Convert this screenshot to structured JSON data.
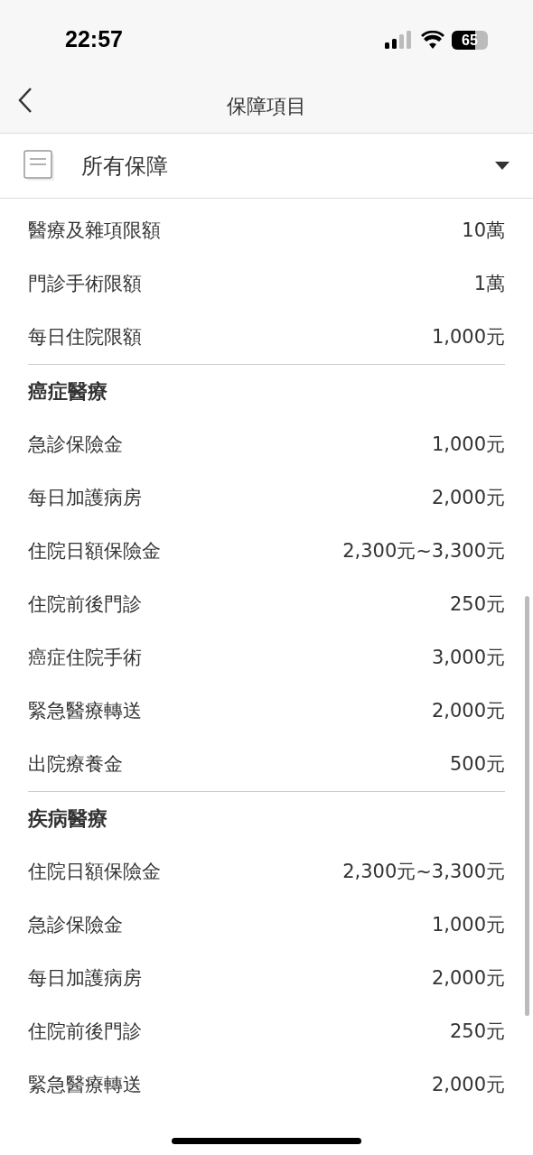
{
  "status_bar": {
    "time": "22:57",
    "battery": "65"
  },
  "nav": {
    "title": "保障項目"
  },
  "filter": {
    "label": "所有保障"
  },
  "sections": [
    {
      "rows": [
        {
          "label": "醫療及雜項限額",
          "value": "10萬"
        },
        {
          "label": "門診手術限額",
          "value": "1萬"
        },
        {
          "label": "每日住院限額",
          "value": "1,000元"
        }
      ]
    },
    {
      "title": "癌症醫療",
      "rows": [
        {
          "label": "急診保險金",
          "value": "1,000元"
        },
        {
          "label": "每日加護病房",
          "value": "2,000元"
        },
        {
          "label": "住院日額保險金",
          "value": "2,300元~3,300元"
        },
        {
          "label": "住院前後門診",
          "value": "250元"
        },
        {
          "label": "癌症住院手術",
          "value": "3,000元"
        },
        {
          "label": "緊急醫療轉送",
          "value": "2,000元"
        },
        {
          "label": "出院療養金",
          "value": "500元"
        }
      ]
    },
    {
      "title": "疾病醫療",
      "rows": [
        {
          "label": "住院日額保險金",
          "value": "2,300元~3,300元"
        },
        {
          "label": "急診保險金",
          "value": "1,000元"
        },
        {
          "label": "每日加護病房",
          "value": "2,000元"
        },
        {
          "label": "住院前後門診",
          "value": "250元"
        },
        {
          "label": "緊急醫療轉送",
          "value": "2,000元"
        }
      ]
    }
  ]
}
